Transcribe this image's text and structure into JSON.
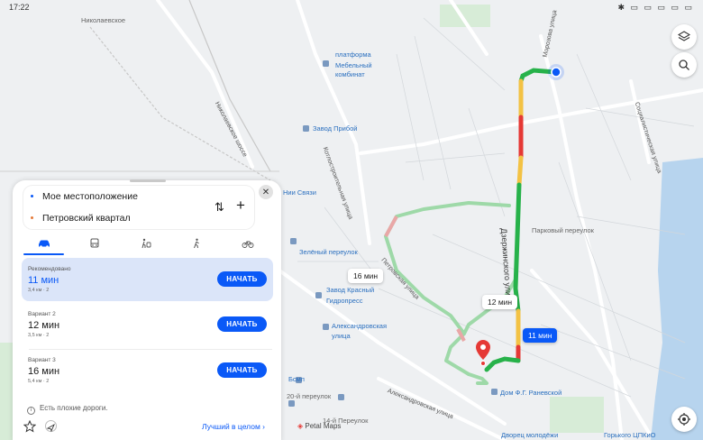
{
  "status_bar": {
    "time": "17:22",
    "icons": "✱ ▭ ▭ ▭ ▭ ▭"
  },
  "map_labels": {
    "nikolaevskoe": "Николаевское",
    "platform": "платформа",
    "furniture_1": "Мебельный",
    "furniture_2": "комбинат",
    "zavod_priboy": "Завод Прибой",
    "nii_svyazi": "Нии Связи",
    "zeleny": "Зелёный переулок",
    "krasny_1": "Завод Красный",
    "krasny_2": "Гидропресс",
    "alex_1": "Александровская",
    "alex_2": "улица",
    "bsmp": "Бсмп",
    "lane20": "20-й переулок",
    "lane14": "14-й Переулок",
    "ranevskoy": "Дом Ф.Г. Раневской",
    "dvorets": "Дворец молодёжи",
    "gorky": "Горького ЦПКиО",
    "parkovy": "Парковый переулок",
    "dzerzhinsky": "Дзержинского улица",
    "petrovsky_st": "Петровская улица",
    "morozov": "Морозова улица",
    "kotlostroy": "Котлостроительная улица",
    "nikolaevskoe_hwy": "Николаевское шоссе",
    "alexandrovskaya_st": "Александровская улица",
    "socialist": "Социалистическая улица"
  },
  "route_badges": {
    "alt1": "16 мин",
    "alt2": "12 мин",
    "main": "11 мин"
  },
  "attribution": "Petal Maps",
  "panel": {
    "origin": "Мое местоположение",
    "destination": "Петровский квартал",
    "swap_icon": "⇅",
    "add_icon": "+",
    "close_icon": "✕",
    "options": [
      {
        "label": "Рекомендовано",
        "time": "11 мин",
        "meta": "3,4 км · 2",
        "button": "НАЧАТЬ"
      },
      {
        "label": "Вариант 2",
        "time": "12 мин",
        "meta": "3,5 км · 2",
        "button": "НАЧАТЬ"
      },
      {
        "label": "Вариант 3",
        "time": "16 мин",
        "meta": "5,4 км · 2",
        "button": "НАЧАТЬ"
      }
    ],
    "warning": "Есть плохие дороги.",
    "best_overall": "Лучший в целом",
    "transport_modes": [
      "car-icon",
      "bus-icon",
      "walk-transit-icon",
      "walk-icon",
      "bike-icon"
    ]
  },
  "colors": {
    "accent": "#0a59f7",
    "traffic_green": "#27b24a",
    "traffic_yellow": "#f3c244",
    "traffic_red": "#e53935",
    "alt_route": "#9ed9a8"
  }
}
